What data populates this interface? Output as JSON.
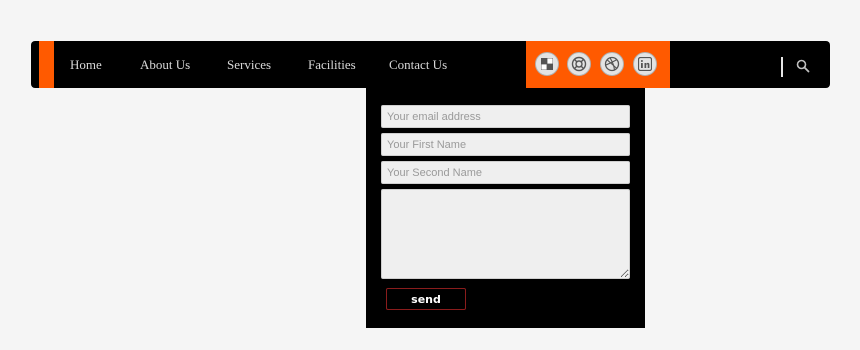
{
  "nav": {
    "items": [
      {
        "label": "Home"
      },
      {
        "label": "About Us"
      },
      {
        "label": "Services"
      },
      {
        "label": "Facilities"
      },
      {
        "label": "Contact Us"
      }
    ],
    "social": [
      {
        "icon": "delicious-icon"
      },
      {
        "icon": "lifebuoy-icon"
      },
      {
        "icon": "dribbble-icon"
      },
      {
        "icon": "linkedin-icon"
      }
    ],
    "search_icon": "search-icon"
  },
  "form": {
    "email_placeholder": "Your email address",
    "first_name_placeholder": "Your First Name",
    "second_name_placeholder": "Your Second Name",
    "message_placeholder": "",
    "send_label": "send"
  },
  "colors": {
    "accent": "#ff5a00",
    "navbar": "#000000",
    "page_background": "#f5f5f5",
    "field_background": "#efefef"
  }
}
